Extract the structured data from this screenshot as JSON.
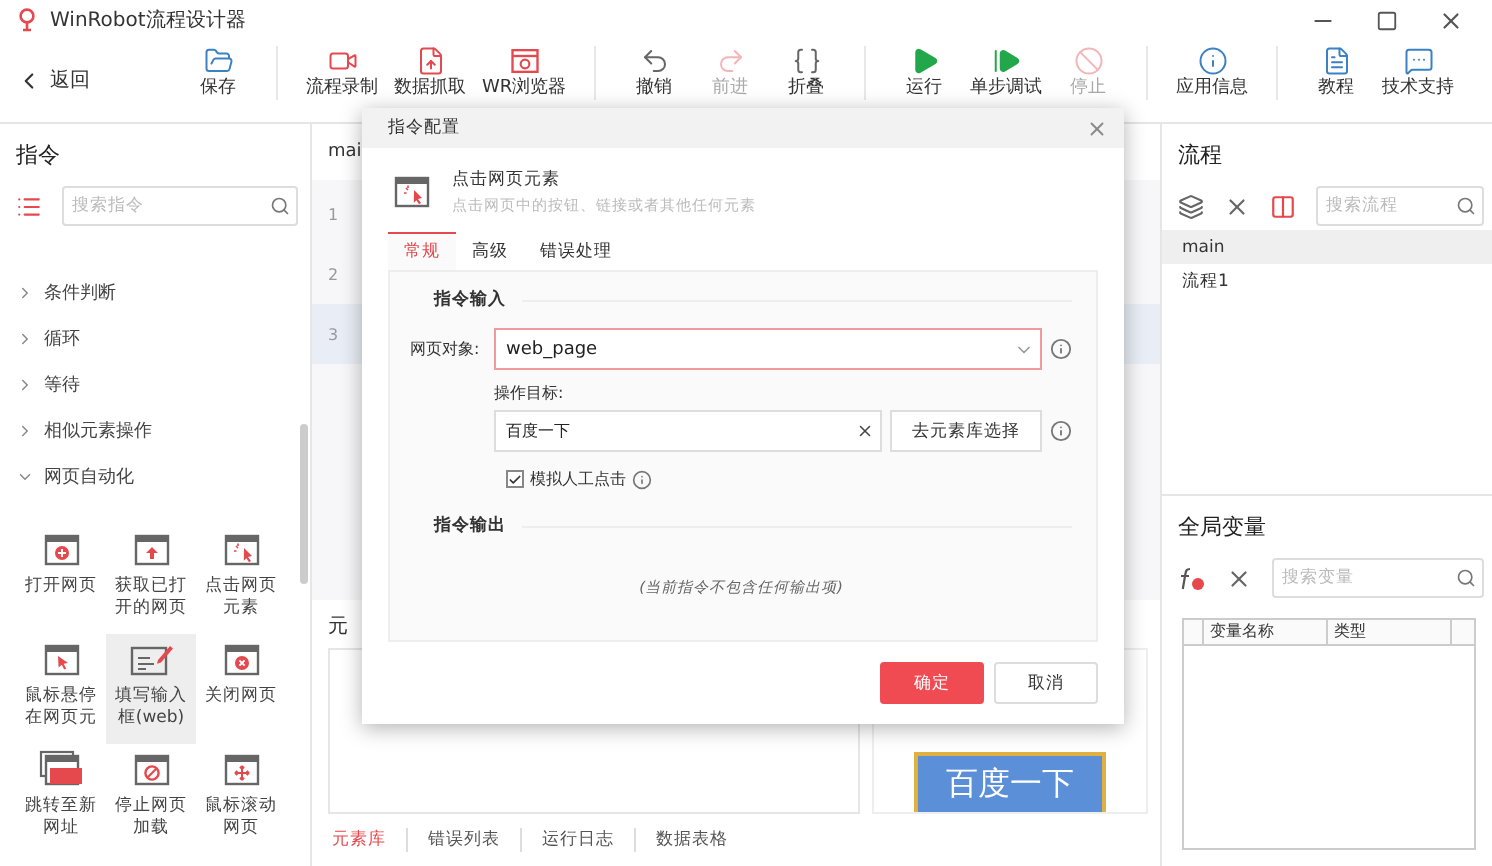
{
  "window": {
    "title": "WinRobot流程设计器"
  },
  "toolbar": {
    "back": "返回",
    "groups": [
      [
        {
          "label": "保存",
          "disabled": false
        }
      ],
      [
        {
          "label": "流程录制",
          "disabled": false
        },
        {
          "label": "数据抓取",
          "disabled": false
        },
        {
          "label": "WR浏览器",
          "disabled": false
        }
      ],
      [
        {
          "label": "撤销",
          "disabled": false
        },
        {
          "label": "前进",
          "disabled": true
        },
        {
          "label": "折叠",
          "disabled": false
        }
      ],
      [
        {
          "label": "运行",
          "disabled": false
        },
        {
          "label": "单步调试",
          "disabled": false
        },
        {
          "label": "停止",
          "disabled": true
        }
      ],
      [
        {
          "label": "应用信息",
          "disabled": false
        }
      ],
      [
        {
          "label": "教程",
          "disabled": false
        },
        {
          "label": "技术支持",
          "disabled": false
        }
      ]
    ]
  },
  "commands": {
    "title": "指令",
    "search": {
      "placeholder": "搜索指令"
    },
    "categories": [
      {
        "label": "条件判断",
        "expanded": false
      },
      {
        "label": "循环",
        "expanded": false
      },
      {
        "label": "等待",
        "expanded": false
      },
      {
        "label": "相似元素操作",
        "expanded": false
      },
      {
        "label": "网页自动化",
        "expanded": true
      }
    ],
    "items": [
      {
        "label": "打开网页",
        "selected": false
      },
      {
        "label": "获取已打开的网页",
        "selected": false
      },
      {
        "label": "点击网页元素",
        "selected": false
      },
      {
        "label": "鼠标悬停在网页元",
        "selected": false
      },
      {
        "label": "填写输入框(web)",
        "selected": true
      },
      {
        "label": "关闭网页",
        "selected": false
      },
      {
        "label": "跳转至新网址",
        "selected": false
      },
      {
        "label": "停止网页加载",
        "selected": false
      },
      {
        "label": "鼠标滚动网页",
        "selected": false
      }
    ]
  },
  "editor": {
    "tab": "mai",
    "lines": [
      {
        "number": "1",
        "selected": false
      },
      {
        "number": "2",
        "selected": false
      },
      {
        "number": "3",
        "selected": true
      }
    ],
    "bottom_panel": {
      "title": "元",
      "preview": "百度一下",
      "tabs": [
        {
          "label": "元素库",
          "selected": true
        },
        {
          "label": "错误列表",
          "selected": false
        },
        {
          "label": "运行日志",
          "selected": false
        },
        {
          "label": "数据表格",
          "selected": false
        }
      ]
    }
  },
  "dialog": {
    "title": "指令配置",
    "command": {
      "name": "点击网页元素",
      "description": "点击网页中的按钮、链接或者其他任何元素"
    },
    "tabs": [
      {
        "label": "常规",
        "selected": true
      },
      {
        "label": "高级",
        "selected": false
      },
      {
        "label": "错误处理",
        "selected": false
      }
    ],
    "input_section": "指令输入",
    "page_object": {
      "label": "网页对象:",
      "value": "web_page",
      "error": true
    },
    "target": {
      "label": "操作目标:",
      "value": "百度一下",
      "button": "去元素库选择"
    },
    "simulate": {
      "label": "模拟人工点击",
      "checked": true
    },
    "output_section": "指令输出",
    "output_empty": "(当前指令不包含任何输出项)",
    "buttons": [
      {
        "label": "确定",
        "primary": true
      },
      {
        "label": "取消",
        "primary": false
      }
    ]
  },
  "flows": {
    "title": "流程",
    "search": {
      "placeholder": "搜索流程"
    },
    "items": [
      {
        "label": "main",
        "selected": true
      },
      {
        "label": "流程1",
        "selected": false
      }
    ]
  },
  "variables": {
    "title": "全局变量",
    "search": {
      "placeholder": "搜索变量"
    },
    "columns": [
      "变量名称",
      "类型"
    ]
  }
}
